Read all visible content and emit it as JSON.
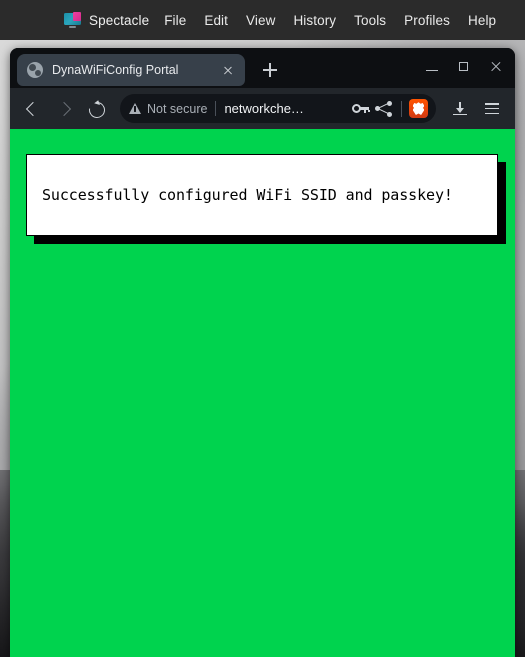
{
  "desktop": {
    "menubar": {
      "app_icon": "spectacle-screenshot-icon",
      "app_name": "Spectacle",
      "items": [
        {
          "label": "File"
        },
        {
          "label": "Edit"
        },
        {
          "label": "View"
        },
        {
          "label": "History"
        },
        {
          "label": "Tools"
        },
        {
          "label": "Profiles"
        },
        {
          "label": "Help"
        }
      ]
    }
  },
  "browser": {
    "tabstrip": {
      "tabs": [
        {
          "title": "DynaWiFiConfig Portal",
          "favicon": "globe-icon",
          "close_icon": "close-icon",
          "active": true
        }
      ],
      "new_tab_icon": "plus-icon",
      "window_controls": {
        "minimize_icon": "minimize-icon",
        "maximize_icon": "maximize-icon",
        "close_icon": "close-icon"
      }
    },
    "toolbar": {
      "back_icon": "chevron-left-icon",
      "forward_icon": "chevron-right-icon",
      "reload_icon": "reload-icon",
      "omnibox": {
        "security_icon": "warning-triangle-icon",
        "security_label": "Not secure",
        "url": "networkche…",
        "key_icon": "key-icon",
        "share_icon": "share-icon",
        "shields_icon": "brave-lion-icon"
      },
      "downloads_icon": "download-icon",
      "menu_icon": "hamburger-menu-icon"
    },
    "page": {
      "background_color": "#00D34E",
      "message_box": {
        "text": "Successfully configured WiFi SSID and passkey!",
        "background_color": "#FFFFFF",
        "border_color": "#000000",
        "shadow_color": "#000000"
      }
    }
  }
}
